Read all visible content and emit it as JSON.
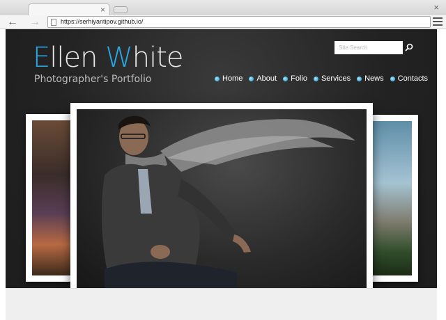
{
  "browser": {
    "url": "https://serhiyantipov.github.io/",
    "close_glyph": "×"
  },
  "site": {
    "logo": {
      "first_initial": "E",
      "first_rest": "llen ",
      "last_initial": "W",
      "last_rest": "hite"
    },
    "tagline": "Photographer's Portfolio",
    "search": {
      "placeholder": "Site Search"
    },
    "nav": [
      "Home",
      "About",
      "Folio",
      "Services",
      "News",
      "Contacts"
    ],
    "accent_color": "#2aa6e0"
  }
}
